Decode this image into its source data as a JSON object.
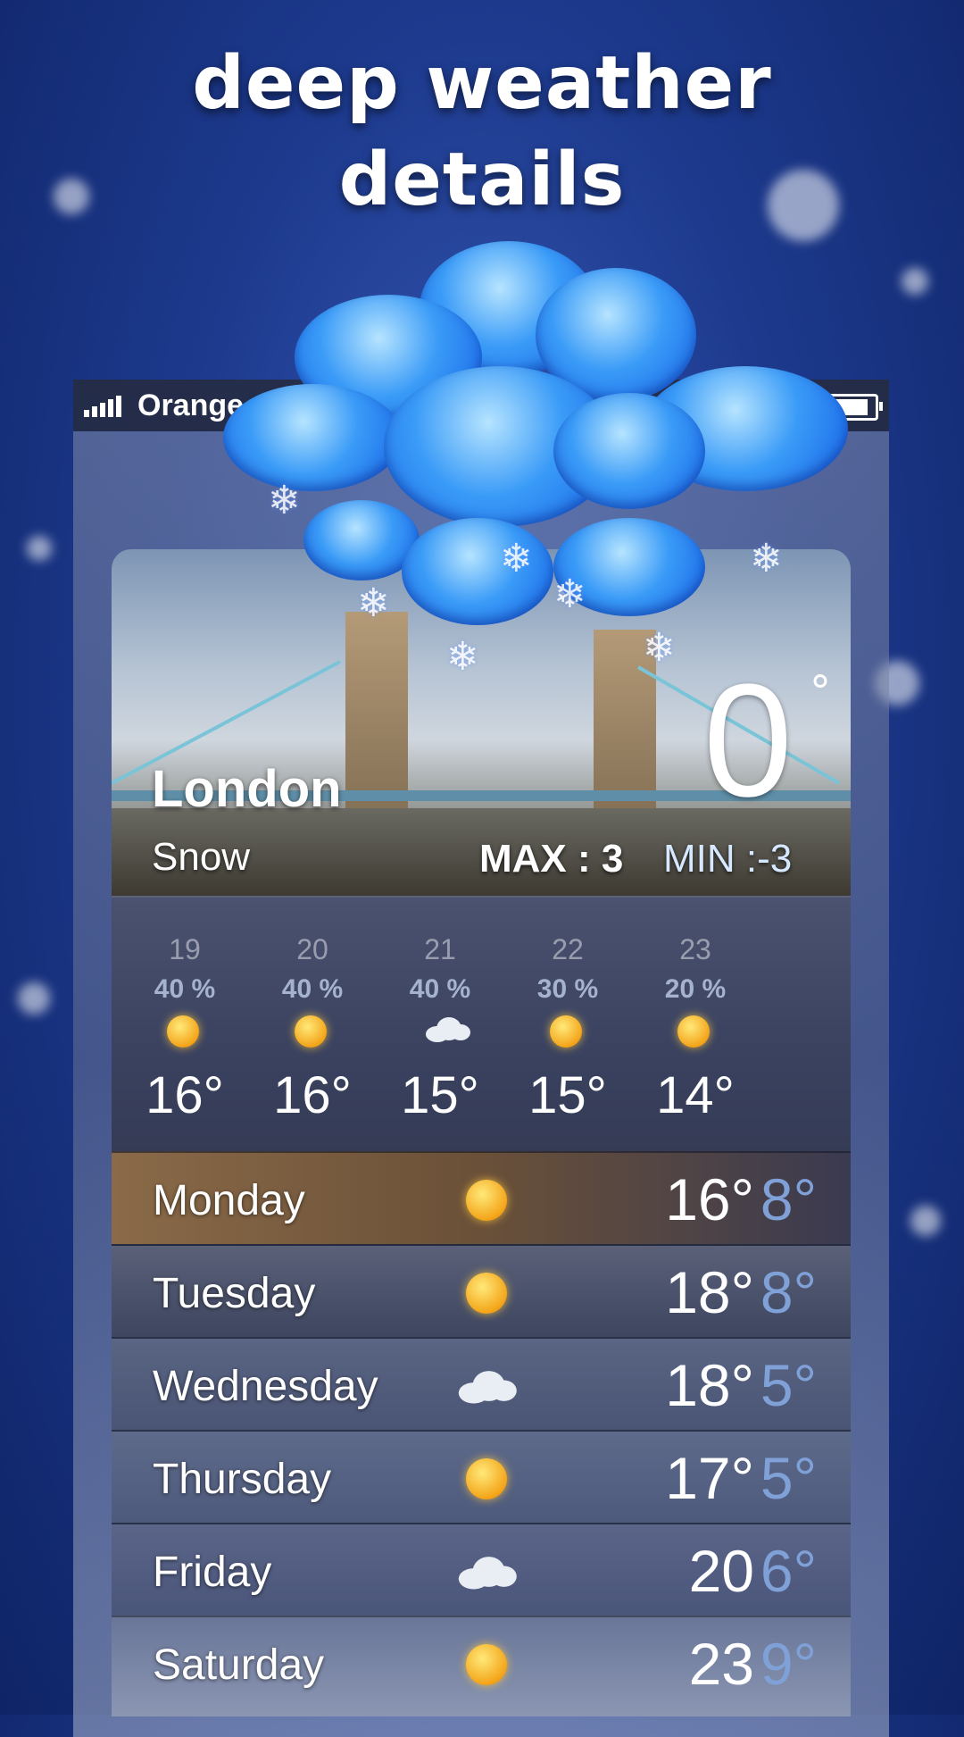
{
  "headline": {
    "line1": "deep weather",
    "line2": "details"
  },
  "status_bar": {
    "carrier": "Orange"
  },
  "current": {
    "city": "London",
    "condition": "Snow",
    "temperature": "0",
    "degree_symbol": "°",
    "max_label": "MAX : 3",
    "min_label": "MIN :-3"
  },
  "hourly": [
    {
      "hour": "19",
      "precip": "40 %",
      "icon": "sun-cloud-icon",
      "temp": "16°"
    },
    {
      "hour": "20",
      "precip": "40 %",
      "icon": "sun-cloud-icon",
      "temp": "16°"
    },
    {
      "hour": "21",
      "precip": "40 %",
      "icon": "cloud-icon",
      "temp": "15°"
    },
    {
      "hour": "22",
      "precip": "30 %",
      "icon": "sun-rain-icon",
      "temp": "15°"
    },
    {
      "hour": "23",
      "precip": "20 %",
      "icon": "sun-rain-icon",
      "temp": "14°"
    }
  ],
  "daily": [
    {
      "day": "Monday",
      "icon": "sun-rain-icon",
      "high": "16°",
      "low": "8°"
    },
    {
      "day": "Tuesday",
      "icon": "sun-icon",
      "high": "18°",
      "low": "8°"
    },
    {
      "day": "Wednesday",
      "icon": "cloud-icon",
      "high": "18°",
      "low": "5°"
    },
    {
      "day": "Thursday",
      "icon": "sun-icon",
      "high": "17°",
      "low": "5°"
    },
    {
      "day": "Friday",
      "icon": "cloud-icon",
      "high": "20",
      "low": "6°"
    },
    {
      "day": "Saturday",
      "icon": "sun-icon",
      "high": "23",
      "low": "9°"
    }
  ],
  "colors": {
    "background": "#1d3a8e",
    "cloud_accent": "#3a9bf7",
    "low_temp": "#7fa1d8"
  }
}
